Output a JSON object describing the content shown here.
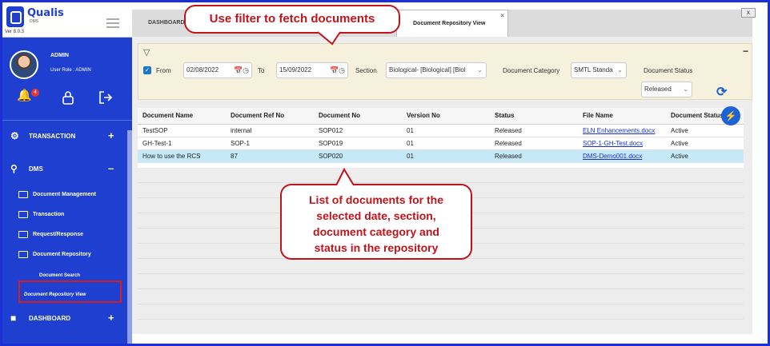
{
  "app": {
    "brand": "Qualis",
    "brand_sub": "DMS",
    "version": "Ver 8.0.3"
  },
  "user": {
    "name": "ADMIN",
    "role": "User Role : ADMIN",
    "notifications": "4"
  },
  "nav": {
    "transaction": "TRANSACTION",
    "dms": "DMS",
    "dashboard": "DASHBOARD",
    "sub_items": [
      "Document Management",
      "Transaction",
      "Request/Response",
      "Document Repository"
    ],
    "repository_children": [
      "Document Search",
      "Document Repository View"
    ]
  },
  "tabs": {
    "dashboard": "DASHBOARD",
    "active": "Document Repository View",
    "close": "×"
  },
  "window_close": "x",
  "filter": {
    "from_label": "From",
    "from_value": "02/08/2022",
    "to_label": "To",
    "to_value": "15/09/2022",
    "section_label": "Section",
    "section_value": "Biological- [Biological]  [Biol",
    "category_label": "Document Category",
    "category_value": "SMTL Standa",
    "status_label": "Document Status",
    "status_value": "Released",
    "collapse": "−"
  },
  "table": {
    "headers": [
      "Document Name",
      "Document Ref No",
      "Document No",
      "Version No",
      "Status",
      "File Name",
      "Document Status"
    ],
    "rows": [
      [
        "TestSOP",
        "internal",
        "SOP012",
        "01",
        "Released",
        "ELN Enhancements.docx",
        "Active"
      ],
      [
        "GH-Test-1",
        "SOP-1",
        "SOP019",
        "01",
        "Released",
        "SOP-1-GH-Test.docx",
        "Active"
      ],
      [
        "How to use the RCS",
        "87",
        "SOP020",
        "01",
        "Released",
        "DMS-Demo001.docx",
        "Active"
      ]
    ]
  },
  "callouts": {
    "top": "Use filter to fetch documents",
    "bottom": [
      "List of  documents for the",
      "selected date, section,",
      "document category and",
      "status in the repository"
    ]
  },
  "colors": {
    "sidebar": "#1e3fd0",
    "accent": "#1e63d6",
    "callout": "#c0141a",
    "selected_row": "#c6e9f8"
  }
}
